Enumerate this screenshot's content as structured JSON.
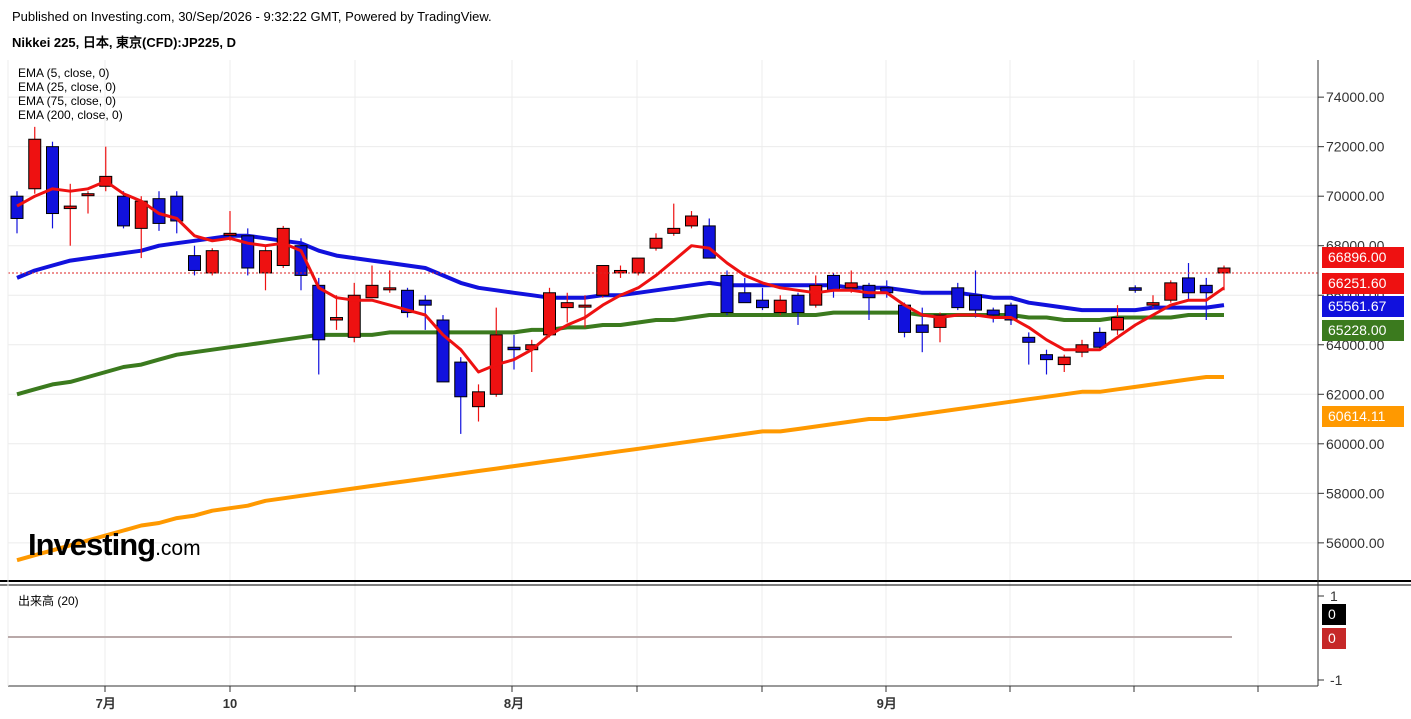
{
  "header": {
    "published": "Published on Investing.com, 30/Sep/2026 - 9:32:22 GMT, Powered by TradingView.",
    "symbol": "Nikkei 225, 日本, 東京(CFD):JP225, D"
  },
  "logo": {
    "main": "Investing",
    "suffix": ".com"
  },
  "colors": {
    "up": "#ee1111",
    "down": "#1111dd",
    "ema5": "#ee1111",
    "ema25": "#1111dd",
    "ema75": "#3b7a1e",
    "ema200": "#ff9900",
    "grid": "#ececec",
    "price_line": "#dd2222"
  },
  "chart_data": [
    {
      "type": "candlestick",
      "ylim": [
        54500,
        75500
      ],
      "y_ticks": [
        "74000.00",
        "72000.00",
        "70000.00",
        "68000.00",
        "66000.00",
        "64000.00",
        "62000.00",
        "60000.00",
        "58000.00",
        "56000.00"
      ],
      "y_tick_values": [
        74000,
        72000,
        70000,
        68000,
        66000,
        64000,
        62000,
        60000,
        58000,
        56000
      ],
      "x_labels": [
        {
          "label": "7月",
          "index": 5
        },
        {
          "label": "10",
          "index": 12
        },
        {
          "label": "8月",
          "index": 28
        },
        {
          "label": "9月",
          "index": 49
        }
      ],
      "indicators": [
        "EMA (5, close, 0)",
        "EMA (25, close, 0)",
        "EMA (75, close, 0)",
        "EMA (200, close, 0)"
      ],
      "candles": [
        [
          70000,
          70200,
          68500,
          69100
        ],
        [
          70300,
          72800,
          70100,
          72300
        ],
        [
          72000,
          72200,
          68700,
          69300
        ],
        [
          69500,
          70500,
          68000,
          69600
        ],
        [
          70100,
          70200,
          69300,
          70100
        ],
        [
          70400,
          72000,
          70200,
          70800
        ],
        [
          70000,
          70200,
          68700,
          68800
        ],
        [
          68700,
          70000,
          67500,
          69800
        ],
        [
          69900,
          70200,
          68600,
          68900
        ],
        [
          70000,
          70200,
          68500,
          69000
        ],
        [
          67600,
          68000,
          66800,
          67000
        ],
        [
          66900,
          67900,
          66800,
          67800
        ],
        [
          68500,
          69400,
          68200,
          68500
        ],
        [
          68400,
          68700,
          66800,
          67100
        ],
        [
          66900,
          68000,
          66200,
          67800
        ],
        [
          67200,
          68800,
          67100,
          68700
        ],
        [
          68000,
          68300,
          66200,
          66800
        ],
        [
          66400,
          66700,
          62800,
          64200
        ],
        [
          65000,
          66000,
          64600,
          65100
        ],
        [
          64300,
          66500,
          64100,
          66000
        ],
        [
          65900,
          67200,
          65900,
          66400
        ],
        [
          66300,
          67000,
          66100,
          66300
        ],
        [
          66200,
          66300,
          65100,
          65300
        ],
        [
          65800,
          66000,
          64600,
          65600
        ],
        [
          65000,
          65200,
          63400,
          62500
        ],
        [
          63300,
          63500,
          60400,
          61900
        ],
        [
          61500,
          62400,
          60900,
          62100
        ],
        [
          62000,
          65500,
          61900,
          64400
        ],
        [
          63900,
          64400,
          63000,
          63800
        ],
        [
          63800,
          64200,
          62900,
          64000
        ],
        [
          64400,
          66300,
          64300,
          66100
        ],
        [
          65500,
          66100,
          64900,
          65700
        ],
        [
          65600,
          66000,
          64700,
          65600
        ],
        [
          66000,
          67200,
          65900,
          67200
        ],
        [
          66900,
          67200,
          66700,
          67000
        ],
        [
          66900,
          67500,
          66800,
          67500
        ],
        [
          67900,
          68500,
          67800,
          68300
        ],
        [
          68500,
          69700,
          68400,
          68700
        ],
        [
          68800,
          69400,
          68700,
          69200
        ],
        [
          68800,
          69100,
          67500,
          67500
        ],
        [
          66800,
          67000,
          65200,
          65300
        ],
        [
          66100,
          66700,
          65700,
          65700
        ],
        [
          65800,
          66300,
          65400,
          65500
        ],
        [
          65300,
          66000,
          65200,
          65800
        ],
        [
          66000,
          66100,
          64800,
          65300
        ],
        [
          65600,
          66800,
          65500,
          66400
        ],
        [
          66800,
          66900,
          65900,
          66200
        ],
        [
          66300,
          67000,
          66100,
          66500
        ],
        [
          66400,
          66500,
          65000,
          65900
        ],
        [
          66300,
          66600,
          65900,
          66100
        ],
        [
          65600,
          65700,
          64300,
          64500
        ],
        [
          64800,
          65500,
          63700,
          64500
        ],
        [
          64700,
          65300,
          64100,
          65200
        ],
        [
          66300,
          66500,
          65400,
          65500
        ],
        [
          66000,
          67000,
          65100,
          65400
        ],
        [
          65400,
          65500,
          64900,
          65200
        ],
        [
          65600,
          65700,
          64800,
          65000
        ],
        [
          64300,
          64500,
          63200,
          64100
        ],
        [
          63600,
          63800,
          62800,
          63400
        ],
        [
          63200,
          63600,
          62900,
          63500
        ],
        [
          63700,
          64200,
          63500,
          64000
        ],
        [
          64500,
          64700,
          63800,
          63900
        ],
        [
          64600,
          65600,
          64400,
          65100
        ],
        [
          66300,
          66400,
          66100,
          66200
        ],
        [
          65600,
          66000,
          65500,
          65700
        ],
        [
          65800,
          66600,
          65700,
          66500
        ],
        [
          66700,
          67300,
          65800,
          66100
        ],
        [
          66400,
          66700,
          65000,
          66100
        ],
        [
          66900,
          67200,
          66200,
          67100
        ]
      ],
      "series": [
        {
          "name": "EMA (5, close, 0)",
          "values": [
            69600,
            70000,
            70300,
            70200,
            70300,
            70600,
            70100,
            69800,
            69300,
            69100,
            68400,
            68200,
            68300,
            68100,
            68000,
            68100,
            67800,
            66300,
            65900,
            65800,
            65800,
            65600,
            65400,
            65200,
            64400,
            63800,
            62900,
            63200,
            63400,
            63800,
            64400,
            64800,
            65100,
            65600,
            66000,
            66300,
            66800,
            67400,
            68000,
            67900,
            67300,
            66800,
            66500,
            66300,
            66200,
            66100,
            66200,
            66200,
            66100,
            66100,
            65600,
            65200,
            65100,
            65200,
            65200,
            65100,
            65100,
            64700,
            64200,
            63800,
            63800,
            63800,
            64300,
            64800,
            65200,
            65600,
            65800,
            65800,
            66300
          ]
        },
        {
          "name": "EMA (25, close, 0)",
          "values": [
            66700,
            67000,
            67200,
            67400,
            67500,
            67600,
            67700,
            67800,
            68000,
            68100,
            68200,
            68300,
            68400,
            68400,
            68300,
            68200,
            68100,
            67800,
            67600,
            67500,
            67400,
            67300,
            67200,
            67100,
            66800,
            66500,
            66300,
            66200,
            66100,
            66000,
            65900,
            65900,
            65900,
            66000,
            66000,
            66100,
            66200,
            66300,
            66400,
            66500,
            66400,
            66400,
            66400,
            66400,
            66400,
            66400,
            66400,
            66300,
            66300,
            66300,
            66200,
            66100,
            66100,
            66100,
            66000,
            65900,
            65900,
            65700,
            65600,
            65500,
            65400,
            65400,
            65400,
            65400,
            65500,
            65500,
            65500,
            65500,
            65600
          ]
        },
        {
          "name": "EMA (75, close, 0)",
          "values": [
            62000,
            62200,
            62400,
            62500,
            62700,
            62900,
            63100,
            63200,
            63400,
            63600,
            63700,
            63800,
            63900,
            64000,
            64100,
            64200,
            64300,
            64400,
            64400,
            64400,
            64400,
            64500,
            64500,
            64500,
            64500,
            64500,
            64500,
            64500,
            64500,
            64600,
            64600,
            64700,
            64700,
            64800,
            64800,
            64900,
            65000,
            65000,
            65100,
            65200,
            65200,
            65200,
            65200,
            65200,
            65200,
            65200,
            65300,
            65300,
            65300,
            65300,
            65300,
            65200,
            65200,
            65200,
            65200,
            65200,
            65200,
            65100,
            65100,
            65000,
            65000,
            65000,
            65100,
            65100,
            65100,
            65100,
            65200,
            65200,
            65200
          ]
        },
        {
          "name": "EMA (200, close, 0)",
          "values": [
            55300,
            55500,
            55700,
            55900,
            56100,
            56300,
            56500,
            56700,
            56800,
            57000,
            57100,
            57300,
            57400,
            57500,
            57700,
            57800,
            57900,
            58000,
            58100,
            58200,
            58300,
            58400,
            58500,
            58600,
            58700,
            58800,
            58900,
            59000,
            59100,
            59200,
            59300,
            59400,
            59500,
            59600,
            59700,
            59800,
            59900,
            60000,
            60100,
            60200,
            60300,
            60400,
            60500,
            60500,
            60600,
            60700,
            60800,
            60900,
            61000,
            61000,
            61100,
            61200,
            61300,
            61400,
            61500,
            61600,
            61700,
            61800,
            61900,
            62000,
            62100,
            62100,
            62200,
            62300,
            62400,
            62500,
            62600,
            62700,
            62700
          ]
        }
      ],
      "last_values": [
        {
          "label": "66896.00",
          "color": "#ee1111"
        },
        {
          "label": "66251.60",
          "color": "#ee1111"
        },
        {
          "label": "65561.67",
          "color": "#1111dd"
        },
        {
          "label": "65228.00",
          "color": "#3b7a1e"
        },
        {
          "label": "60614.11",
          "color": "#ff9900"
        }
      ]
    },
    {
      "type": "bar",
      "title": "出来高 (20)",
      "y_ticks": [
        "1",
        "-1"
      ],
      "last_values": [
        {
          "label": "0",
          "color": "#000000"
        },
        {
          "label": "0",
          "color": "#c62828"
        }
      ]
    }
  ]
}
